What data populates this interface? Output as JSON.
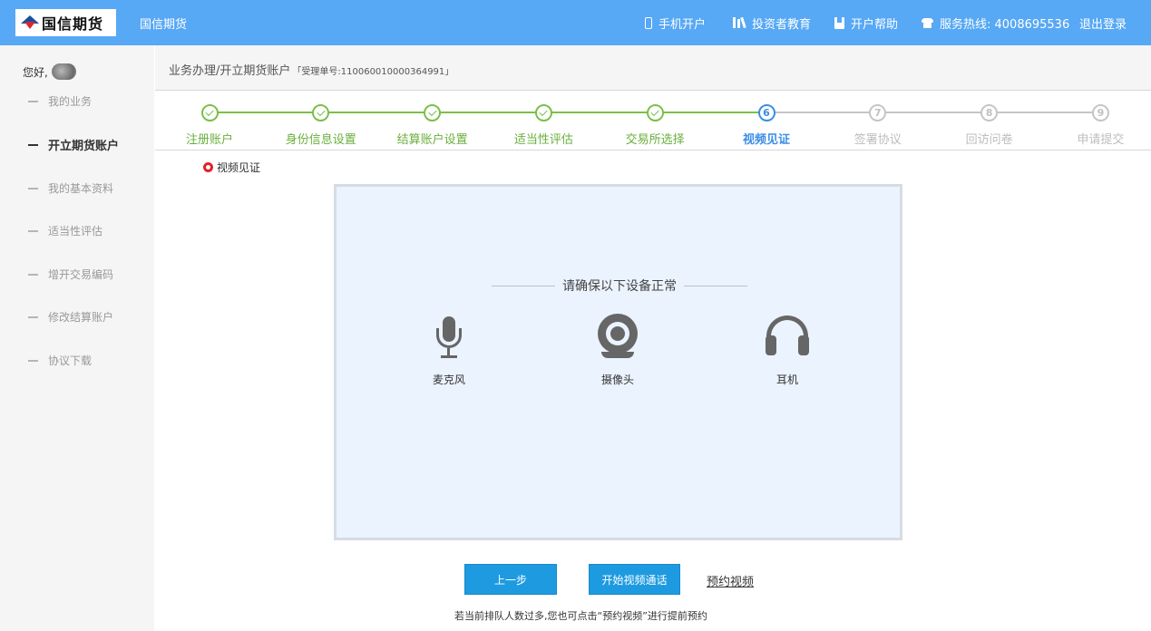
{
  "header": {
    "logo_text": "国信期货",
    "brand_name": "国信期货",
    "nav": [
      {
        "icon": "phone-icon",
        "label": "手机开户"
      },
      {
        "icon": "books-icon",
        "label": "投资者教育"
      },
      {
        "icon": "book-icon",
        "label": "开户帮助"
      },
      {
        "icon": "telephone-icon",
        "label": "服务热线: 4008695536"
      }
    ],
    "logout": "退出登录",
    "bg_color": "#57a8f5"
  },
  "sidebar": {
    "greeting": "您好,",
    "items": [
      {
        "label": "我的业务",
        "active": false
      },
      {
        "label": "开立期货账户",
        "active": true
      },
      {
        "label": "我的基本资料",
        "active": false
      },
      {
        "label": "适当性评估",
        "active": false
      },
      {
        "label": "增开交易编码",
        "active": false
      },
      {
        "label": "修改结算账户",
        "active": false
      },
      {
        "label": "协议下载",
        "active": false
      }
    ]
  },
  "breadcrumb": {
    "path": "业务办理/开立期货账户",
    "ticket": "「受理单号:110060010000364991」"
  },
  "steps": [
    {
      "number": "1",
      "label": "注册账户",
      "state": "done"
    },
    {
      "number": "2",
      "label": "身份信息设置",
      "state": "done"
    },
    {
      "number": "3",
      "label": "结算账户设置",
      "state": "done"
    },
    {
      "number": "4",
      "label": "适当性评估",
      "state": "done"
    },
    {
      "number": "5",
      "label": "交易所选择",
      "state": "done"
    },
    {
      "number": "6",
      "label": "视频见证",
      "state": "current"
    },
    {
      "number": "7",
      "label": "签署协议",
      "state": "todo"
    },
    {
      "number": "8",
      "label": "回访问卷",
      "state": "todo"
    },
    {
      "number": "9",
      "label": "申请提交",
      "state": "todo"
    }
  ],
  "section": {
    "title": "视频见证"
  },
  "panel": {
    "heading": "请确保以下设备正常",
    "devices": [
      {
        "icon": "microphone-icon",
        "label": "麦克风"
      },
      {
        "icon": "camera-icon",
        "label": "摄像头"
      },
      {
        "icon": "headphones-icon",
        "label": "耳机"
      }
    ]
  },
  "actions": {
    "prev_label": "上一步",
    "start_label": "开始视频通话",
    "book_label": "预约视频",
    "hint": "若当前排队人数过多,您也可点击“预约视频”进行提前预约"
  },
  "colors": {
    "done": "#7bbf4a",
    "current": "#3a8ee6",
    "todo": "#c5c5c5",
    "button": "#1e9be0"
  }
}
